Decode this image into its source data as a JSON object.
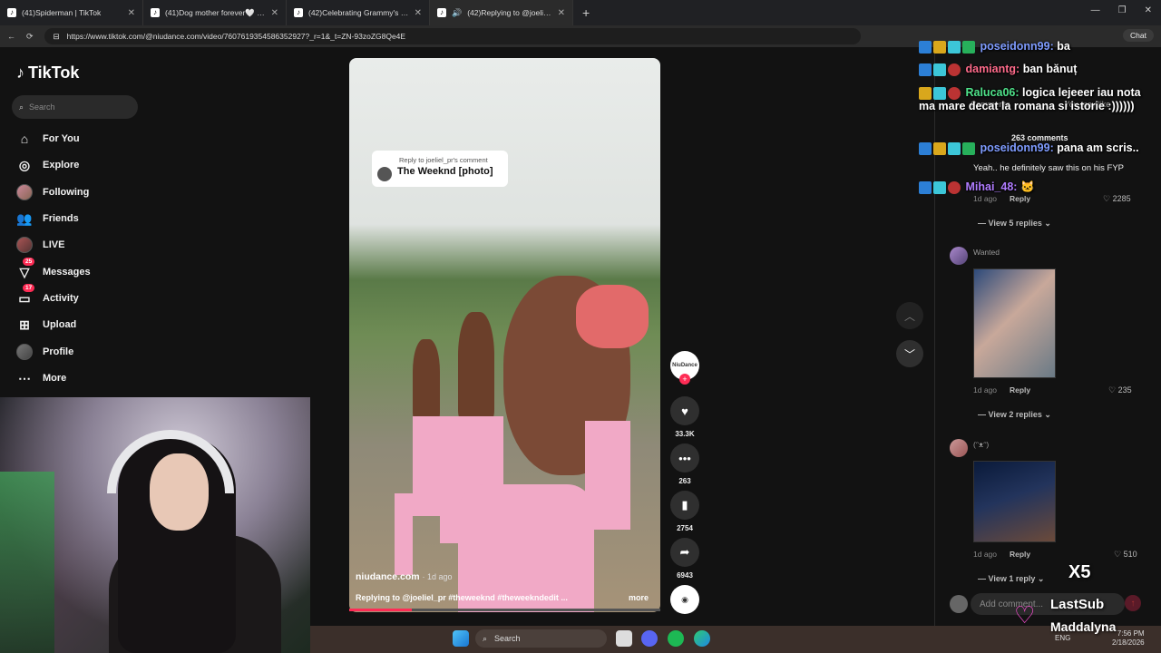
{
  "browser": {
    "tabs": [
      {
        "title": "(41)Spiderman | TikTok",
        "active": false
      },
      {
        "title": "(41)Dog mother forever🤍 🤍 🤍 ...",
        "active": false
      },
      {
        "title": "(42)Celebrating Grammy's Best Du...",
        "active": false
      },
      {
        "title": "(42)Replying to @joeliel_pr #...",
        "active": true
      }
    ],
    "url": "https://www.tiktok.com/@niudance.com/video/7607619354586352927?_r=1&_t=ZN-93zoZG8Qe4E",
    "chat_label": "Chat"
  },
  "tiktok": {
    "logo_text": "TikTok",
    "search_placeholder": "Search",
    "nav": [
      {
        "label": "For You",
        "icon": "home-icon"
      },
      {
        "label": "Explore",
        "icon": "compass-icon"
      },
      {
        "label": "Following",
        "icon": "following-avatar-icon"
      },
      {
        "label": "Friends",
        "icon": "friends-icon"
      },
      {
        "label": "LIVE",
        "icon": "live-avatar-icon"
      },
      {
        "label": "Messages",
        "icon": "messages-icon",
        "badge": "25"
      },
      {
        "label": "Activity",
        "icon": "activity-icon",
        "badge": "17"
      },
      {
        "label": "Upload",
        "icon": "upload-icon"
      },
      {
        "label": "Profile",
        "icon": "profile-avatar-icon"
      },
      {
        "label": "More",
        "icon": "more-icon"
      }
    ]
  },
  "video": {
    "reply_small": "Reply to joeliel_pr's comment",
    "reply_big": "The Weeknd [photo]",
    "author": "niudance.com",
    "age": "· 1d ago",
    "caption": "Replying to @joeliel_pr #theweeknd #theweekndedit ...",
    "more": "more",
    "progress_fraction": 0.2,
    "actions": {
      "likes": "33.3K",
      "comments": "263",
      "saves": "2754",
      "shares": "6943",
      "author_label": "NiuDance"
    }
  },
  "comments_panel": {
    "tabs": [
      "Comments",
      "You may like"
    ],
    "count": "263 comments",
    "items": [
      {
        "text": "Yeah.. he definitely saw this on his FYP",
        "age": "1d ago",
        "reply": "Reply",
        "likes": "2285",
        "view_replies": "View 5 replies"
      },
      {
        "name": "Wanted",
        "age": "1d ago",
        "reply": "Reply",
        "likes": "235",
        "view_replies": "View 2 replies"
      },
      {
        "name": "(ᵔᴥᵔ)",
        "age": "1d ago",
        "reply": "Reply",
        "likes": "510",
        "view_replies": "View 1 reply"
      }
    ],
    "add_placeholder": "Add comment..."
  },
  "stream_chat": [
    {
      "user": "poseidonn99:",
      "msg": "ba",
      "user_color": "#7f9cff"
    },
    {
      "user": "damiantg:",
      "msg": "ban bănuț",
      "user_color": "#ff6b8b"
    },
    {
      "user": "Raluca06:",
      "msg": "logica lejeeer iau nota ma mare decat la romana si istorie :))))))",
      "user_color": "#4fe38a"
    },
    {
      "user": "poseidonn99:",
      "msg": "pana am scris..",
      "user_color": "#7f9cff"
    },
    {
      "user": "Mihai_48:",
      "msg": "",
      "user_color": "#b07cff"
    }
  ],
  "sub_alert": {
    "count": "X5",
    "label": "LastSub",
    "name": "Maddalyna"
  },
  "taskbar": {
    "search": "Search",
    "lang": "ENG",
    "time": "7:56 PM",
    "date": "2/18/2026"
  }
}
